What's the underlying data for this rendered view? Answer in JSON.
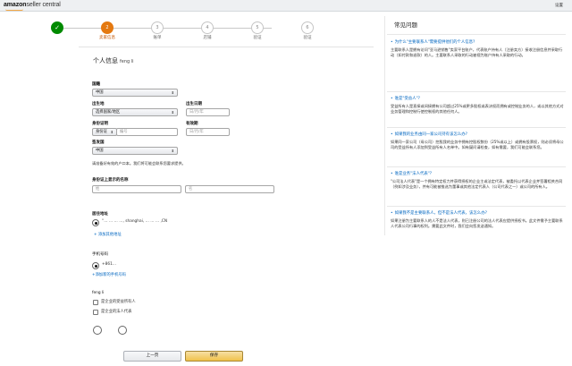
{
  "header": {
    "logo_main": "amazon",
    "logo_sub": "seller central",
    "top_right": "设置"
  },
  "stepper": {
    "steps": [
      {
        "num": "✓",
        "label": ""
      },
      {
        "num": "2",
        "label": "卖家信息"
      },
      {
        "num": "3",
        "label": "账单"
      },
      {
        "num": "4",
        "label": "店铺"
      },
      {
        "num": "5",
        "label": "验证"
      },
      {
        "num": "6",
        "label": "验证"
      }
    ]
  },
  "form": {
    "title": "个人信息",
    "title_name": "feng li",
    "nationality_label": "国籍",
    "nationality_value": "中国",
    "birthplace_label": "出生地",
    "birthplace_value": "选择国家/地区",
    "birthdate_label": "出生日期",
    "birthdate_placeholder": "日/月/年",
    "idproof_label": "身份证明",
    "idproof_type": "身份证",
    "idproof_number_placeholder": "编号",
    "expiry_label": "有效期",
    "expiry_placeholder": "日/月/年",
    "issuer_label": "签发国",
    "issuer_value": "中国",
    "note": "请准备好有效的户口本。我们将可能会联系您要求提供。",
    "name_on_id_label": "身份证上显示的名称",
    "surname_placeholder": "姓",
    "givenname_placeholder": "名",
    "address_label": "居住地址",
    "address_value": "“… … … …, shanghai, … … … ,CN",
    "add_address_link": "+ 添加其他地址",
    "phone_label": "手机号码",
    "phone_value": "+861…",
    "add_phone_link": "+添加新的手机号码",
    "person_name": "feng li",
    "check1": "是企业的受益所有人",
    "check2": "是企业的法人代表",
    "prev_button": "上一页",
    "save_button": "保存"
  },
  "faq": {
    "title": "常见问题",
    "items": [
      {
        "q": "为什么\"主要联系人\"需要提供他们的个人信息?",
        "a": "主要联系人是拥有访问\"亚马逊销售\"卖家平台账户，代表账户持有人（注册卖方）接收注册信息并采取行动（如付款和退款）的人。主要联系人采取的行动被视为账户持有人采取的行动。"
      },
      {
        "q": "谁是\"受益人\"?",
        "a": "受益所有人是直接或间接拥有公司超过25%或更多股权或表决权而拥有或控制业务的人，或以其他方式对业务管理和控制行使控制权的其他任何人。"
      },
      {
        "q": "如果我的业务由同一家公司持有该怎么办?",
        "a": "如果同一家公司（母公司）控股我的业务中拥有控股权数份（25%或以上）或拥有投票权，则必须将母公司的受益所有人添加到受益所有人名单中。如有疑问请检查，如有需要，我们可能会联系您。"
      },
      {
        "q": "谁是业务\"法人代表\"?",
        "a": "\"公司法人代表\"是一个拥有特定权力并获得授权的企业主或法定代表，被委托以代表企业并签署相关合同（例如涉及业务），并有可能被推选为董事或其他法定代表人（公司代表之一）或公司的所有人。"
      },
      {
        "q": "如果我不是主要联系人，但不是法人代表，该怎么办?",
        "a": "如果注册为主要联系人的人不是法人代表，则已注册公司的法人代表应提供授权书。此文件需予主要联系人代表公司行事的权利。需要此文件时，我们会向您发送通知。"
      }
    ]
  }
}
